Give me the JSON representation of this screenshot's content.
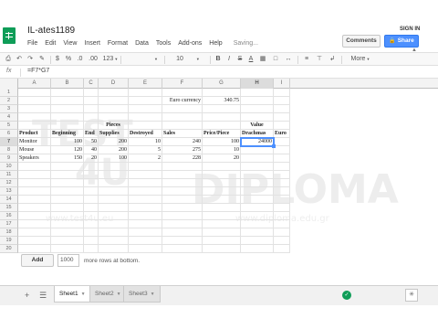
{
  "header": {
    "doc_title": "IL-ates1189",
    "sign_in": "SIGN IN",
    "comments_label": "Comments",
    "share_label": "Share",
    "menu": [
      "File",
      "Edit",
      "View",
      "Insert",
      "Format",
      "Data",
      "Tools",
      "Add-ons",
      "Help"
    ],
    "saving": "Saving..."
  },
  "toolbar": {
    "currency": "$",
    "percent": "%",
    "dec_dec": ".0",
    "inc_dec": ".00",
    "number_format": "123",
    "font_size": "10",
    "more": "More"
  },
  "formula_bar": {
    "fx": "fx",
    "formula": "=F7*G7"
  },
  "grid": {
    "columns": [
      "A",
      "B",
      "C",
      "D",
      "E",
      "F",
      "G",
      "H",
      "I"
    ],
    "selected_column": "H",
    "rows": [
      "1",
      "2",
      "3",
      "4",
      "5",
      "6",
      "7",
      "8",
      "9",
      "10",
      "11",
      "12",
      "13",
      "14",
      "15",
      "16",
      "17",
      "18",
      "19",
      "20"
    ],
    "selected_row": "7",
    "euro_label": "Euro currency",
    "euro_value": "340.75",
    "pieces_label": "Pieces",
    "value_label": "Value",
    "headers": [
      "Product",
      "Beginning",
      "End",
      "Supplies",
      "Destroyed",
      "Sales",
      "Price/Piece",
      "Drachmas",
      "Euro"
    ],
    "data": [
      {
        "product": "Monitor",
        "beginning": "100",
        "end": "50",
        "supplies": "200",
        "destroyed": "10",
        "sales": "240",
        "price": "100",
        "drachmas": "24000"
      },
      {
        "product": "Mouse",
        "beginning": "120",
        "end": "40",
        "supplies": "200",
        "destroyed": "5",
        "sales": "275",
        "price": "10",
        "drachmas": ""
      },
      {
        "product": "Speakers",
        "beginning": "150",
        "end": "20",
        "supplies": "100",
        "destroyed": "2",
        "sales": "228",
        "price": "20",
        "drachmas": ""
      }
    ]
  },
  "add_rows": {
    "button_label": "Add",
    "count": "1000",
    "suffix": "more rows at bottom."
  },
  "tabs": {
    "sheets": [
      "Sheet1",
      "Sheet2",
      "Sheet3"
    ],
    "active": "Sheet1"
  },
  "watermark": {
    "line1": "TEST",
    "line2": "4U",
    "brand": "DIPLOMA",
    "url1": "www.test4u.eu",
    "url2": "www.diploma.edu.gr"
  },
  "colors": {
    "accent": "#4d90fe",
    "sheets_green": "#0f9d58"
  }
}
